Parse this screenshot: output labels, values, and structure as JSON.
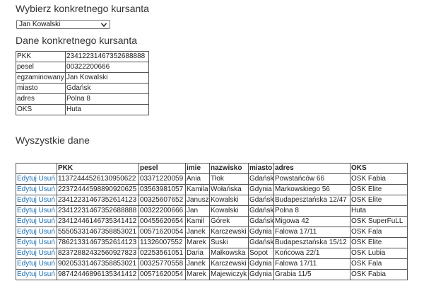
{
  "headings": {
    "select": "Wybierz konkretnego kursanta",
    "details": "Dane konkretnego kursanta",
    "all": "Wyszystkie dane"
  },
  "select": {
    "value": "Jan Kowalski"
  },
  "details": [
    {
      "label": "PKK",
      "value": "23412231467352688888"
    },
    {
      "label": "pesel",
      "value": "00322200666"
    },
    {
      "label": "egzaminowany",
      "value": "Jan Kowalski"
    },
    {
      "label": "miasto",
      "value": "Gdańsk"
    },
    {
      "label": "adres",
      "value": "Polna 8"
    },
    {
      "label": "OKS",
      "value": "Huta"
    }
  ],
  "table": {
    "headers": [
      "",
      "PKK",
      "pesel",
      "imie",
      "nazwisko",
      "miasto",
      "adres",
      "OKS"
    ],
    "edit_label": "Edytuj",
    "delete_label": "Usuń",
    "rows": [
      [
        "11372444526130950622",
        "03371220059",
        "Ania",
        "Tłok",
        "Gdańsk",
        "Powstańców 66",
        "OSK Fabia"
      ],
      [
        "22372444598890920625",
        "03563981057",
        "Kamila",
        "Wołańska",
        "Gdynia",
        "Markowskiego 56",
        "OSK Elite"
      ],
      [
        "23412231467352614123",
        "00325607652",
        "Janusz",
        "Kowalski",
        "Gdańsk",
        "Budapesztańska 12/47",
        "OSK Elite"
      ],
      [
        "23412231467352688888",
        "00322200666",
        "Jan",
        "Kowalski",
        "Gdańsk",
        "Polna 8",
        "Huta"
      ],
      [
        "23412446146735341412",
        "00455620654",
        "Kamil",
        "Górek",
        "Gdańsk",
        "Migowa 42",
        "OSK SuperFuLL"
      ],
      [
        "55505331467358853021",
        "00571620054",
        "Janek",
        "Karczewski",
        "Gdynia",
        "Falowa 17/11",
        "OSK Fala"
      ],
      [
        "78621331467352614123",
        "11326007552",
        "Marek",
        "Suski",
        "Gdańsk",
        "Budapesztańska 15/12",
        "OSK Elite"
      ],
      [
        "82372882432560927823",
        "02253561051",
        "Daria",
        "Małkowska",
        "Sopot",
        "Końcowa 22/1",
        "OSK Lubia"
      ],
      [
        "90205331467358853021",
        "00325770558",
        "Janek",
        "Karczewski",
        "Gdynia",
        "Falowa 17/11",
        "OSK Fala"
      ],
      [
        "98742446896135341412",
        "00571620054",
        "Marek",
        "Majewiczyk",
        "Gdynia",
        "Grabia 11/5",
        "OSK Fabia"
      ]
    ]
  }
}
